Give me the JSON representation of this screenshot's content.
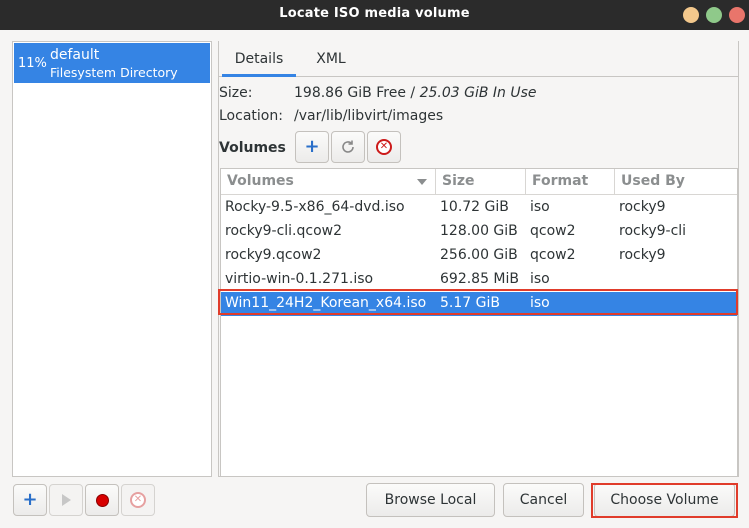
{
  "window": {
    "title": "Locate ISO media volume"
  },
  "pool": {
    "usage": "11%",
    "name": "default",
    "type": "Filesystem Directory"
  },
  "tabs": [
    {
      "label": "Details",
      "active": true
    },
    {
      "label": "XML",
      "active": false
    }
  ],
  "details": {
    "size_label": "Size:",
    "size_free": "198.86 GiB Free",
    "size_sep": " / ",
    "size_in_use": "25.03 GiB In Use",
    "location_label": "Location:",
    "location_value": "/var/lib/libvirt/images",
    "volumes_label": "Volumes"
  },
  "table": {
    "columns": [
      "Volumes",
      "Size",
      "Format",
      "Used By"
    ],
    "rows": [
      {
        "name": "Rocky-9.5-x86_64-dvd.iso",
        "size": "10.72 GiB",
        "format": "iso",
        "used_by": "rocky9"
      },
      {
        "name": "rocky9-cli.qcow2",
        "size": "128.00 GiB",
        "format": "qcow2",
        "used_by": "rocky9-cli"
      },
      {
        "name": "rocky9.qcow2",
        "size": "256.00 GiB",
        "format": "qcow2",
        "used_by": "rocky9"
      },
      {
        "name": "virtio-win-0.1.271.iso",
        "size": "692.85 MiB",
        "format": "iso",
        "used_by": ""
      },
      {
        "name": "Win11_24H2_Korean_x64.iso",
        "size": "5.17 GiB",
        "format": "iso",
        "used_by": ""
      }
    ],
    "selected_index": 4
  },
  "buttons": {
    "browse_local": "Browse Local",
    "cancel": "Cancel",
    "choose_volume": "Choose Volume"
  },
  "colors": {
    "selection": "#3584e4",
    "highlight": "#e03c2b",
    "titlebar": "#2b2b2b"
  }
}
